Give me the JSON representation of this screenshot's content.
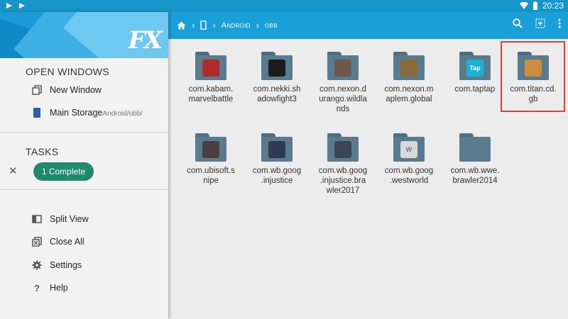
{
  "status_bar": {
    "time": "20:23"
  },
  "drawer": {
    "logo": "FX",
    "open_windows_title": "OPEN WINDOWS",
    "items_top": [
      {
        "label": "New Window",
        "icon": "copy-icon"
      },
      {
        "label": "Main Storage",
        "sub": "Android/obb/",
        "icon": "storage-icon"
      }
    ],
    "tasks_title": "TASKS",
    "task_pill": "1 Complete",
    "items_bottom": [
      {
        "label": "Split View",
        "icon": "split-view-icon"
      },
      {
        "label": "Close All",
        "icon": "close-all-icon"
      },
      {
        "label": "Settings",
        "icon": "gear-icon"
      },
      {
        "label": "Help",
        "icon": "help-icon"
      }
    ]
  },
  "toolbar": {
    "breadcrumbs": [
      "Android",
      "obb"
    ],
    "actions": [
      "search-icon",
      "select-icon",
      "more-icon"
    ]
  },
  "folders": [
    {
      "label": "com.kabam.\nmarvelbattle",
      "thumb": "#b02a2a"
    },
    {
      "label": "com.nekki.sh\nadowfight3",
      "thumb": "#1c1c1c"
    },
    {
      "label": "com.nexon.d\nurango.wildla\nnds",
      "thumb": "#6b5a48"
    },
    {
      "label": "com.nexon.m\naplem.global",
      "thumb": "#8a6a3a"
    },
    {
      "label": "com.taptap",
      "thumb": "#1bb3d3",
      "thumb_text": "Tap"
    },
    {
      "label": "com.titan.cd.\ngb",
      "thumb": "#c98d3d",
      "highlighted": true
    },
    {
      "label": "com.ubisoft.s\nnipe",
      "thumb": "#4b4040"
    },
    {
      "label": "com.wb.goog\n.injustice",
      "thumb": "#2f3b54"
    },
    {
      "label": "com.wb.goog\n.injustice.bra\nwler2017",
      "thumb": "#3b4650"
    },
    {
      "label": "com.wb.goog\n.westworld",
      "thumb": "#d8d8d8",
      "thumb_text": "W"
    },
    {
      "label": "com.wb.wwe.\nbrawler2014",
      "thumb": null
    }
  ]
}
